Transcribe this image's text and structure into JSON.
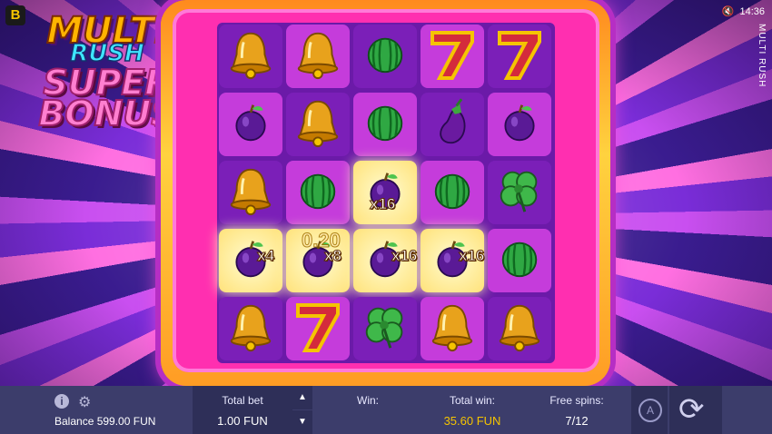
{
  "app": {
    "title": "MULTI RUSH",
    "time": "14:36",
    "brand_letter": "B"
  },
  "logo": {
    "line1": "MULTI",
    "line2": "RUSH",
    "line3": "SUPER",
    "line4": "BONUS"
  },
  "reels": {
    "rows": [
      [
        "bell",
        "bell",
        "watermelon",
        "seven",
        "seven"
      ],
      [
        "plum",
        "bell",
        "watermelon",
        "eggplant",
        "plum"
      ],
      [
        "bell",
        "watermelon",
        "plum",
        "watermelon",
        "clover"
      ],
      [
        "plum",
        "plum",
        "plum",
        "plum",
        "watermelon"
      ],
      [
        "bell",
        "seven",
        "clover",
        "bell",
        "bell"
      ]
    ],
    "multipliers": [
      {
        "label": "x16",
        "row": 2,
        "col": 2
      },
      {
        "label": "x4",
        "row": 3,
        "col": 0
      },
      {
        "label": "x8",
        "row": 3,
        "col": 1
      },
      {
        "label": "x16",
        "row": 3,
        "col": 2
      },
      {
        "label": "x16",
        "row": 3,
        "col": 3
      }
    ],
    "center_win": "0.20"
  },
  "bottom_bar": {
    "balance_label": "Balance 599.00 FUN",
    "total_bet_label": "Total bet",
    "total_bet_value": "1.00 FUN",
    "win_label": "Win:",
    "total_win_label": "Total win:",
    "total_win_value": "35.60 FUN",
    "free_spins_label": "Free spins:",
    "free_spins_value": "7/12",
    "auto_label": "A"
  },
  "colors": {
    "gold": "#f5c400",
    "bar_bg": "#3c3d6b",
    "reel_bg": "#6b1aa8"
  }
}
